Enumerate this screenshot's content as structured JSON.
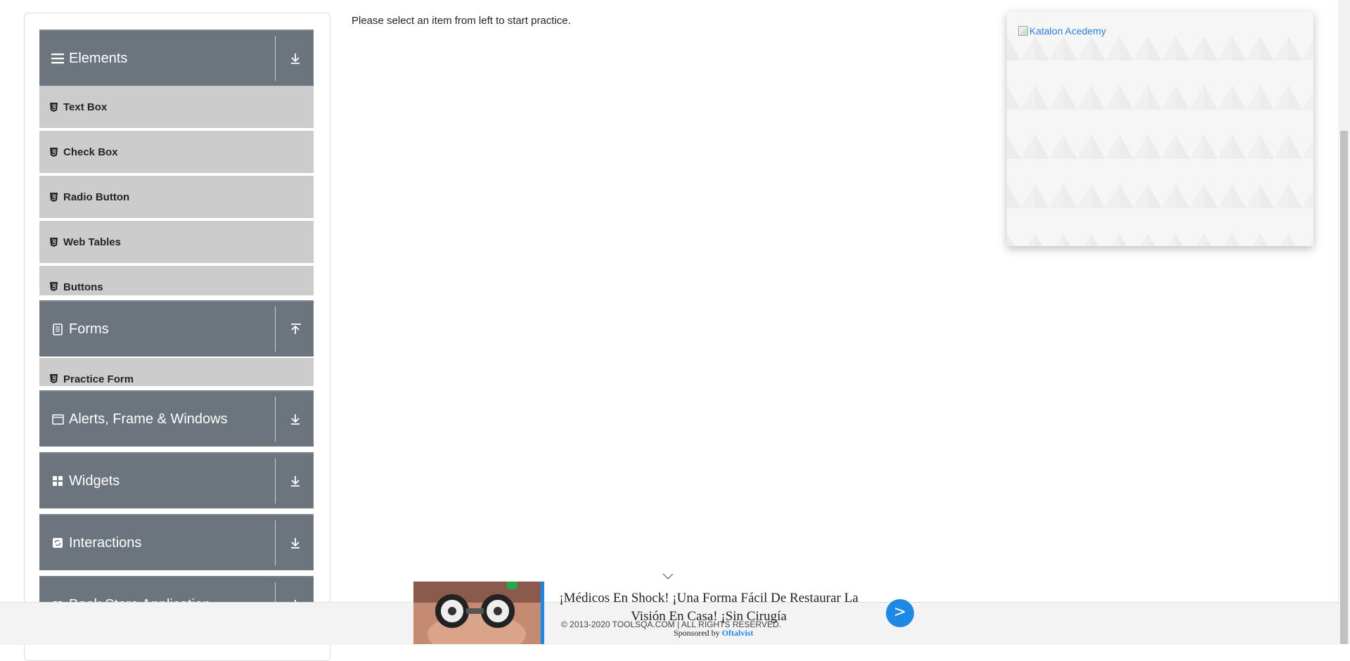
{
  "main": {
    "instruction": "Please select an item from left to start practice."
  },
  "sidebar": {
    "groups": [
      {
        "title": "Elements",
        "icon": "hamburger-icon",
        "toggle": "expand-down-icon",
        "items": [
          "Text Box",
          "Check Box",
          "Radio Button",
          "Web Tables",
          "Buttons"
        ]
      },
      {
        "title": "Forms",
        "icon": "document-icon",
        "toggle": "collapse-up-icon",
        "items": [
          "Practice Form"
        ]
      },
      {
        "title": "Alerts, Frame & Windows",
        "icon": "window-icon",
        "toggle": "expand-down-icon",
        "items": []
      },
      {
        "title": "Widgets",
        "icon": "grid-icon",
        "toggle": "expand-down-icon",
        "items": []
      },
      {
        "title": "Interactions",
        "icon": "refresh-icon",
        "toggle": "expand-down-icon",
        "items": []
      },
      {
        "title": "Book Store Application",
        "icon": "book-icon",
        "toggle": "expand-down-icon",
        "items": []
      }
    ]
  },
  "side_ad": {
    "alt_text": "Katalon Acedemy"
  },
  "footer": {
    "copyright": "© 2013-2020 TOOLSQA.COM | ALL RIGHTS RESERVED."
  },
  "ad_banner": {
    "headline": "¡Médicos En Shock! ¡Una Forma Fácil De Restaurar La Visión En Casa! ¡Sin Cirugía",
    "sponsored_prefix": "Sponsored by",
    "sponsor_name": "Oftalvist",
    "next_label": ">"
  },
  "colors": {
    "group_header_bg": "#6c757d",
    "menu_item_bg": "#cccccc",
    "accent_blue": "#1e88e5"
  }
}
